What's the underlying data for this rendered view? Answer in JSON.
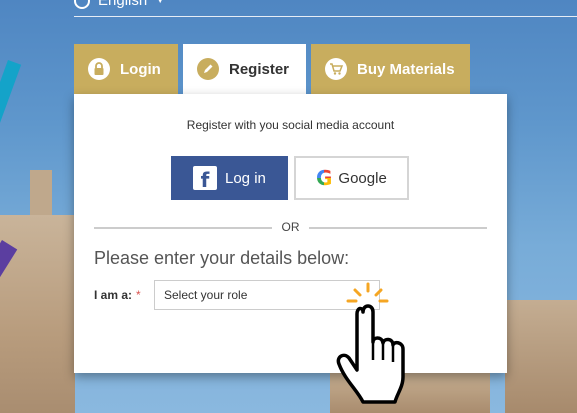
{
  "language": {
    "label": "English",
    "icon": "globe-icon"
  },
  "tabs": [
    {
      "label": "Login",
      "icon": "lock-icon",
      "active": false
    },
    {
      "label": "Register",
      "icon": "pencil-icon",
      "active": true
    },
    {
      "label": "Buy Materials",
      "icon": "cart-icon",
      "active": false
    }
  ],
  "register": {
    "social_title": "Register with you social media account",
    "facebook_label": "Log in",
    "google_label": "Google",
    "or_label": "OR",
    "details_heading": "Please enter your details below:",
    "role_label": "I am a:",
    "required_mark": "*",
    "role_placeholder": "Select your role"
  },
  "colors": {
    "tab_gold": "#c8ad5e",
    "facebook_blue": "#3a5795",
    "cursor_spark": "#f5a623"
  }
}
